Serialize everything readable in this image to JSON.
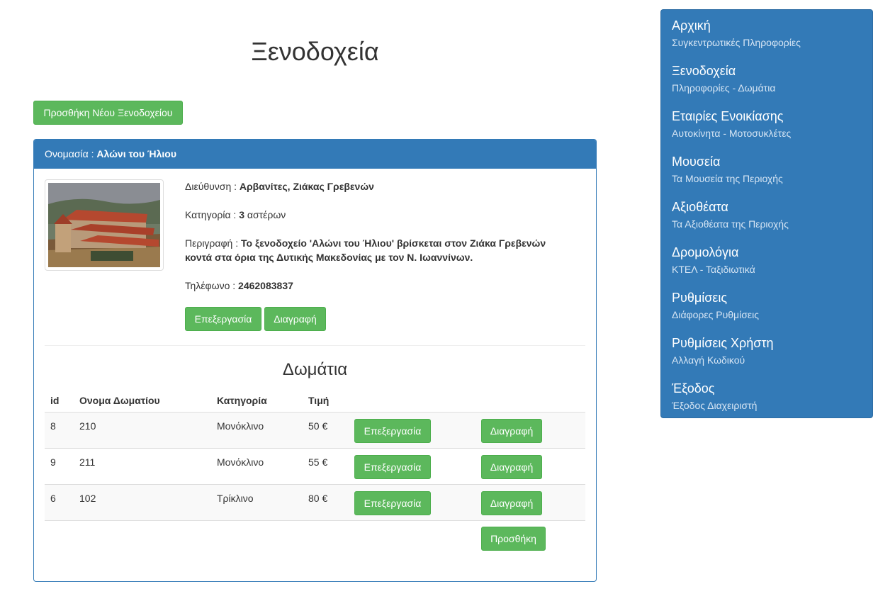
{
  "page": {
    "title": "Ξενοδοχεία"
  },
  "toolbar": {
    "add_hotel_label": "Προσθήκη Νέου Ξενοδοχείου"
  },
  "hotel": {
    "name_label": "Ονομασία :",
    "name": "Αλώνι του Ήλιου",
    "address_label": "Διεύθυνση :",
    "address": "Αρβανίτες, Ζιάκας Γρεβενών",
    "category_label": "Κατηγορία :",
    "category_stars": "3",
    "category_suffix": "αστέρων",
    "description_label": "Περιγραφή :",
    "description": "Το ξενοδοχείο 'Αλώνι του Ήλιου' βρίσκεται στον Ζιάκα Γρεβενών κοντά στα όρια της Δυτικής Μακεδονίας με τον Ν. Ιωαννίνων.",
    "phone_label": "Τηλέφωνο :",
    "phone": "2462083837",
    "edit_label": "Επεξεργασία",
    "delete_label": "Διαγραφή"
  },
  "rooms": {
    "title": "Δωμάτια",
    "columns": [
      "id",
      "Ονομα Δωματίου",
      "Κατηγορία",
      "Τιμή"
    ],
    "rows": [
      {
        "id": "8",
        "name": "210",
        "category": "Μονόκλινο",
        "price": "50 €"
      },
      {
        "id": "9",
        "name": "211",
        "category": "Μονόκλινο",
        "price": "55 €"
      },
      {
        "id": "6",
        "name": "102",
        "category": "Τρίκλινο",
        "price": "80 €"
      }
    ],
    "edit_label": "Επεξεργασία",
    "delete_label": "Διαγραφή",
    "add_label": "Προσθήκη"
  },
  "sidebar": {
    "items": [
      {
        "title": "Αρχική",
        "subtitle": "Συγκεντρωτικές Πληροφορίες"
      },
      {
        "title": "Ξενοδοχεία",
        "subtitle": "Πληροφορίες - Δωμάτια"
      },
      {
        "title": "Εταιρίες Ενοικίασης",
        "subtitle": "Αυτοκίνητα - Μοτοσυκλέτες"
      },
      {
        "title": "Μουσεία",
        "subtitle": "Τα Μουσεία της Περιοχής"
      },
      {
        "title": "Αξιοθέατα",
        "subtitle": "Τα Αξιοθέατα της Περιοχής"
      },
      {
        "title": "Δρομολόγια",
        "subtitle": "ΚΤΕΛ - Ταξιδιωτικά"
      },
      {
        "title": "Ρυθμίσεις",
        "subtitle": "Διάφορες Ρυθμίσεις"
      },
      {
        "title": "Ρυθμίσεις Χρήστη",
        "subtitle": "Αλλαγή Κωδικού"
      },
      {
        "title": "Έξοδος",
        "subtitle": "Έξοδος Διαχειριστή"
      }
    ]
  },
  "colors": {
    "primary": "#337ab7",
    "success": "#5cb85c",
    "text": "#333333"
  }
}
